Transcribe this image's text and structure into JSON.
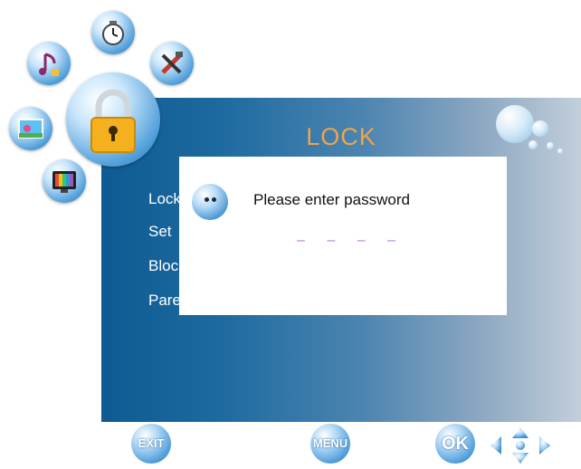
{
  "header": {
    "title": "LOCK"
  },
  "menu": {
    "items": [
      {
        "label": "Lock"
      },
      {
        "label": "Set"
      },
      {
        "label": "Bloc"
      },
      {
        "label": "Pare"
      }
    ]
  },
  "dialog": {
    "prompt": "Please enter password",
    "password_mask": "– – – –"
  },
  "footer": {
    "exit_label": "EXIT",
    "menu_label": "MENU",
    "ok_label": "OK"
  },
  "icons": {
    "main": "lock-icon",
    "ring": [
      "clock-icon",
      "tools-icon",
      "music-icon",
      "picture-icon",
      "tv-icon"
    ]
  },
  "colors": {
    "title": "#f0a44a",
    "panel": "#0e5a92",
    "lock_body": "#f5b01e"
  }
}
